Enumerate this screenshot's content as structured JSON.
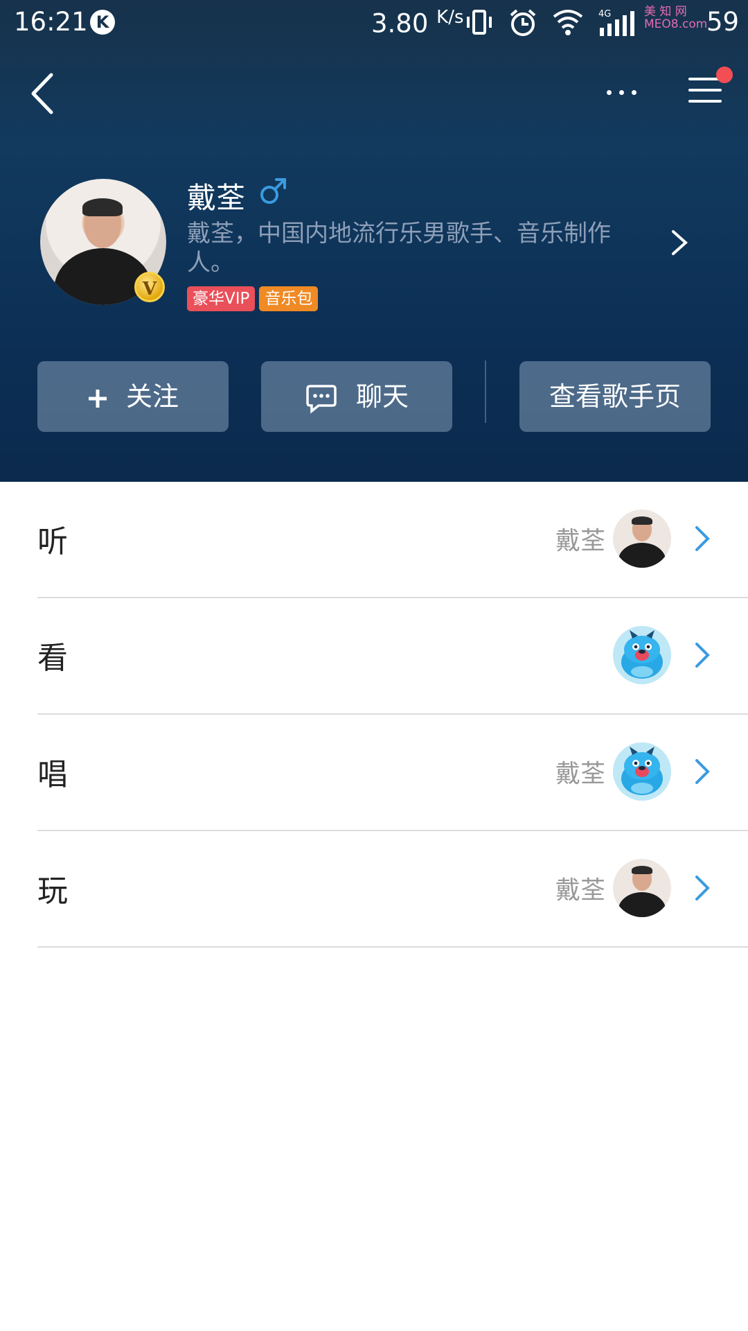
{
  "status_bar": {
    "time": "16:21",
    "speed_value": "3.80",
    "speed_unit": "K/s",
    "network": "4G",
    "battery": "59",
    "watermark": "美 知 网 MEO8.com"
  },
  "profile": {
    "name": "戴荃",
    "bio": "戴荃，中国内地流行乐男歌手、音乐制作人。",
    "badge_letter": "V",
    "tags": [
      "豪华VIP",
      "音乐包"
    ]
  },
  "actions": {
    "follow": "关注",
    "chat": "聊天",
    "artist_page": "查看歌手页"
  },
  "list": [
    {
      "label": "听",
      "owner": "戴荃",
      "thumb": "person-avatar"
    },
    {
      "label": "看",
      "owner": "",
      "thumb": "blue-dog-mascot"
    },
    {
      "label": "唱",
      "owner": "戴荃",
      "thumb": "blue-dog-mascot"
    },
    {
      "label": "玩",
      "owner": "戴荃",
      "thumb": "person-avatar"
    }
  ],
  "colors": {
    "header_top": "#17324b",
    "header_bottom": "#0b2a4d",
    "accent_blue": "#3a9be0",
    "vip_tag": "#e9505a",
    "music_tag": "#ef8a25",
    "notification_dot": "#f24e54"
  }
}
